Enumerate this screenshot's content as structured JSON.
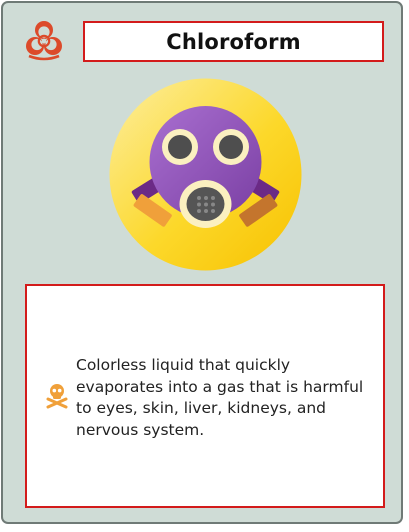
{
  "card": {
    "title": "Chloroform",
    "description": "Colorless liquid that quickly evaporates into a gas that is harmful to eyes, skin, liver, kidneys, and nervous system.",
    "header_icon": "biohazard-icon",
    "illustration_icon": "gas-mask-icon",
    "description_icon": "skull-crossbones-icon"
  },
  "colors": {
    "card_background": "#cfdcd6",
    "border_accent": "#d31b1b",
    "hazard_red": "#dc4a2a",
    "illustration_yellow": "#fcd21a",
    "mask_purple": "#8a4fb0",
    "skull_orange": "#f0a03a"
  }
}
